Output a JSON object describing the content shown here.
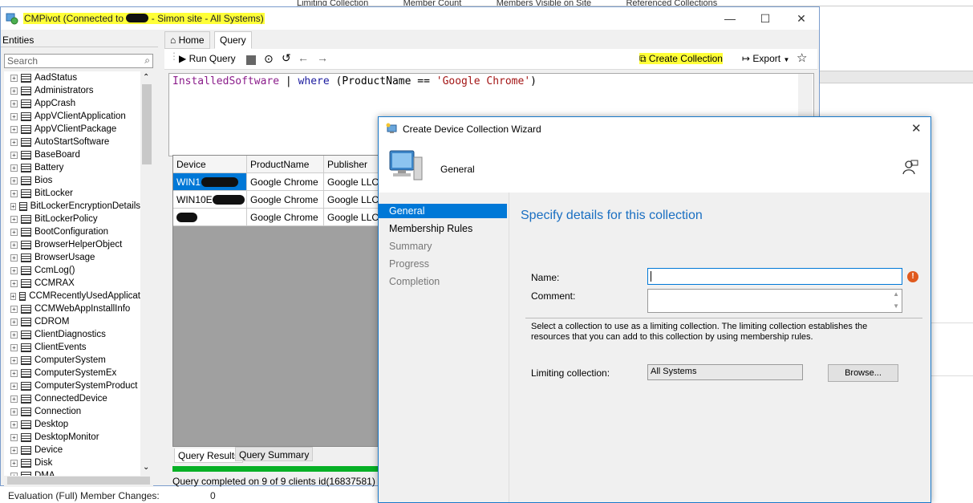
{
  "background": {
    "headers": [
      "Limiting Collection",
      "Member Count",
      "Members Visible on Site",
      "Referenced Collections"
    ]
  },
  "window": {
    "title": "CMPivot (Connected to",
    "title_suffix": "- Simon site - All Systems)",
    "controls": {
      "minimize": "—",
      "maximize": "☐",
      "close": "✕"
    }
  },
  "entities": {
    "header": "Entities",
    "search_placeholder": "Search",
    "items": [
      "AadStatus",
      "Administrators",
      "AppCrash",
      "AppVClientApplication",
      "AppVClientPackage",
      "AutoStartSoftware",
      "BaseBoard",
      "Battery",
      "Bios",
      "BitLocker",
      "BitLockerEncryptionDetails",
      "BitLockerPolicy",
      "BootConfiguration",
      "BrowserHelperObject",
      "BrowserUsage",
      "CcmLog()",
      "CCMRAX",
      "CCMRecentlyUsedApplicat",
      "CCMWebAppInstallInfo",
      "CDROM",
      "ClientDiagnostics",
      "ClientEvents",
      "ComputerSystem",
      "ComputerSystemEx",
      "ComputerSystemProduct",
      "ConnectedDevice",
      "Connection",
      "Desktop",
      "DesktopMonitor",
      "Device",
      "Disk",
      "DMA"
    ]
  },
  "tabs": {
    "home": "Home",
    "query": "Query"
  },
  "toolbar": {
    "run_query": "Run Query",
    "create_collection": "Create Collection",
    "export": "Export"
  },
  "query": {
    "table": "InstalledSoftware",
    "pipe": " | ",
    "kw": "where",
    "open": " (ProductName == ",
    "str": "'Google Chrome'",
    "close": ")"
  },
  "results": {
    "columns": [
      "Device",
      "ProductName",
      "Publisher"
    ],
    "rows": [
      {
        "device": "WIN1",
        "product": "Google Chrome",
        "publisher": "Google LLC"
      },
      {
        "device": "WIN10E",
        "product": "Google Chrome",
        "publisher": "Google LLC"
      },
      {
        "device": "",
        "product": "Google Chrome",
        "publisher": "Google LLC"
      }
    ],
    "tabs": [
      "Query Results",
      "Query Summary"
    ],
    "progress": 1.0,
    "status": "Query completed on 9 of 9 clients  id(16837581)"
  },
  "bottom": {
    "label": "Evaluation (Full) Member Changes:",
    "value": "0"
  },
  "dialog": {
    "title": "Create Device Collection Wizard",
    "page": "General",
    "steps": [
      "General",
      "Membership Rules",
      "Summary",
      "Progress",
      "Completion"
    ],
    "heading": "Specify details for this collection",
    "name_label": "Name:",
    "name_value": "",
    "comment_label": "Comment:",
    "comment_value": "",
    "info": "Select a collection to use as a limiting collection. The limiting collection establishes the resources that you can add to this collection by using membership rules.",
    "limiting_label": "Limiting collection:",
    "limiting_value": "All Systems",
    "browse": "Browse..."
  }
}
